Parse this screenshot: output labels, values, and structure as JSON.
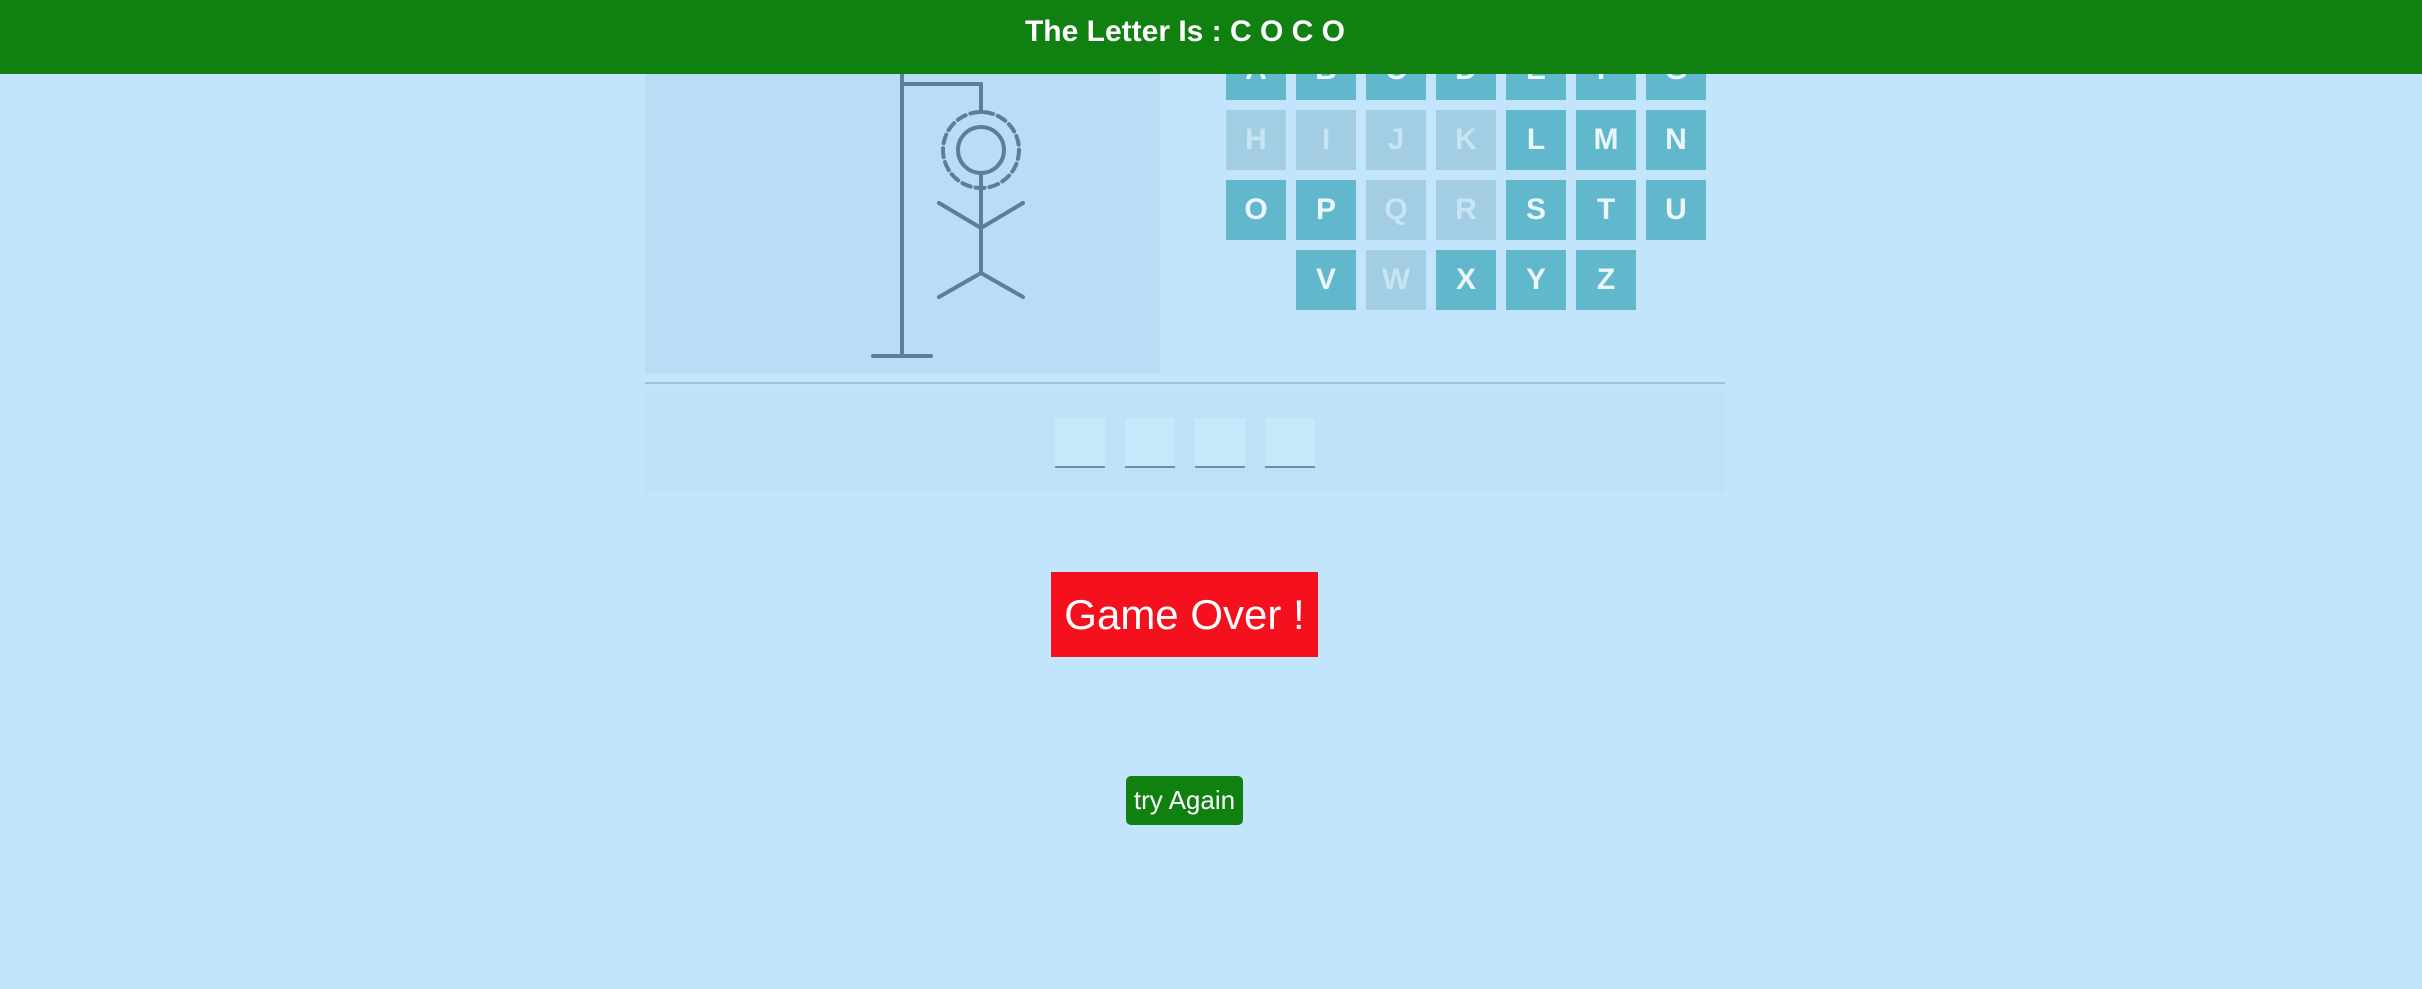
{
  "header": {
    "title": "The Letter Is : C O C O"
  },
  "keyboard": {
    "keys": [
      {
        "letter": "A",
        "used": false
      },
      {
        "letter": "B",
        "used": false
      },
      {
        "letter": "C",
        "used": false
      },
      {
        "letter": "D",
        "used": false
      },
      {
        "letter": "E",
        "used": false
      },
      {
        "letter": "F",
        "used": false
      },
      {
        "letter": "G",
        "used": false
      },
      {
        "letter": "H",
        "used": true
      },
      {
        "letter": "I",
        "used": true
      },
      {
        "letter": "J",
        "used": true
      },
      {
        "letter": "K",
        "used": true
      },
      {
        "letter": "L",
        "used": false
      },
      {
        "letter": "M",
        "used": false
      },
      {
        "letter": "N",
        "used": false
      },
      {
        "letter": "O",
        "used": false
      },
      {
        "letter": "P",
        "used": false
      },
      {
        "letter": "Q",
        "used": true
      },
      {
        "letter": "R",
        "used": true
      },
      {
        "letter": "S",
        "used": false
      },
      {
        "letter": "T",
        "used": false
      },
      {
        "letter": "U",
        "used": false
      },
      {
        "letter": "V",
        "used": false
      },
      {
        "letter": "W",
        "used": true
      },
      {
        "letter": "X",
        "used": false
      },
      {
        "letter": "Y",
        "used": false
      },
      {
        "letter": "Z",
        "used": false
      }
    ]
  },
  "word": {
    "slots": [
      "",
      "",
      "",
      ""
    ]
  },
  "status": {
    "message": "Game Over !"
  },
  "actions": {
    "try_again_label": "try Again"
  },
  "colors": {
    "background": "#c2e5fb",
    "header": "#108011",
    "key": "#61b8cc",
    "key_used": "#a3cde3",
    "game_over": "#f5101e",
    "button": "#108011",
    "figure": "#5a7f96"
  }
}
